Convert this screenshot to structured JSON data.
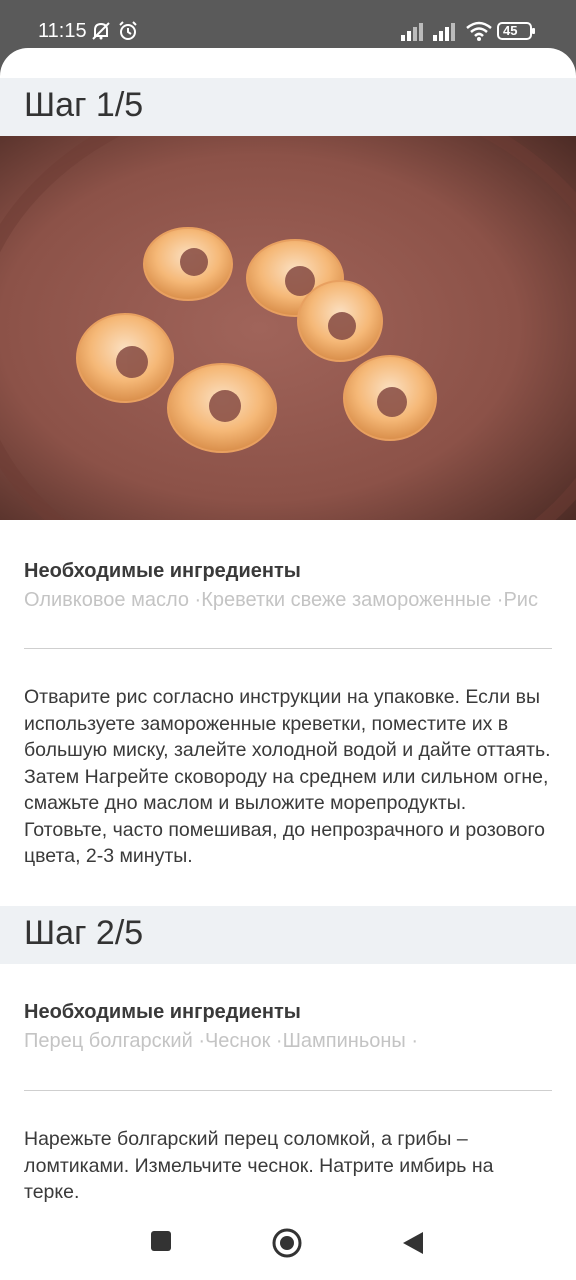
{
  "status": {
    "time": "11:15",
    "battery": "45"
  },
  "steps": [
    {
      "title": "Шаг 1/5",
      "ingredients_title": "Необходимые ингредиенты",
      "ingredients": "Оливковое масло ·Креветки свеже замороженные ·Рис",
      "text": "Отварите рис согласно инструкции на упаковке. Если вы используете замороженные креветки, поместите их в большую миску, залейте холодной водой и дайте оттаять. Затем Нагрейте сковороду на среднем или сильном огне, смажьте дно маслом и выложите морепродукты. Готовьте, часто помешивая, до непрозрачного и розового цвета, 2-3 минуты."
    },
    {
      "title": "Шаг 2/5",
      "ingredients_title": "Необходимые ингредиенты",
      "ingredients": "Перец болгарский ·Чеснок ·Шампиньоны ·",
      "text": "Нарежьте болгарский перец соломкой, а грибы – ломтиками. Измельчите чеснок. Натрите имбирь на терке."
    }
  ],
  "icons": {
    "photo": "shrimp-in-pan-photo",
    "nav": [
      "recents-square-icon",
      "home-circle-icon",
      "back-triangle-icon"
    ]
  }
}
